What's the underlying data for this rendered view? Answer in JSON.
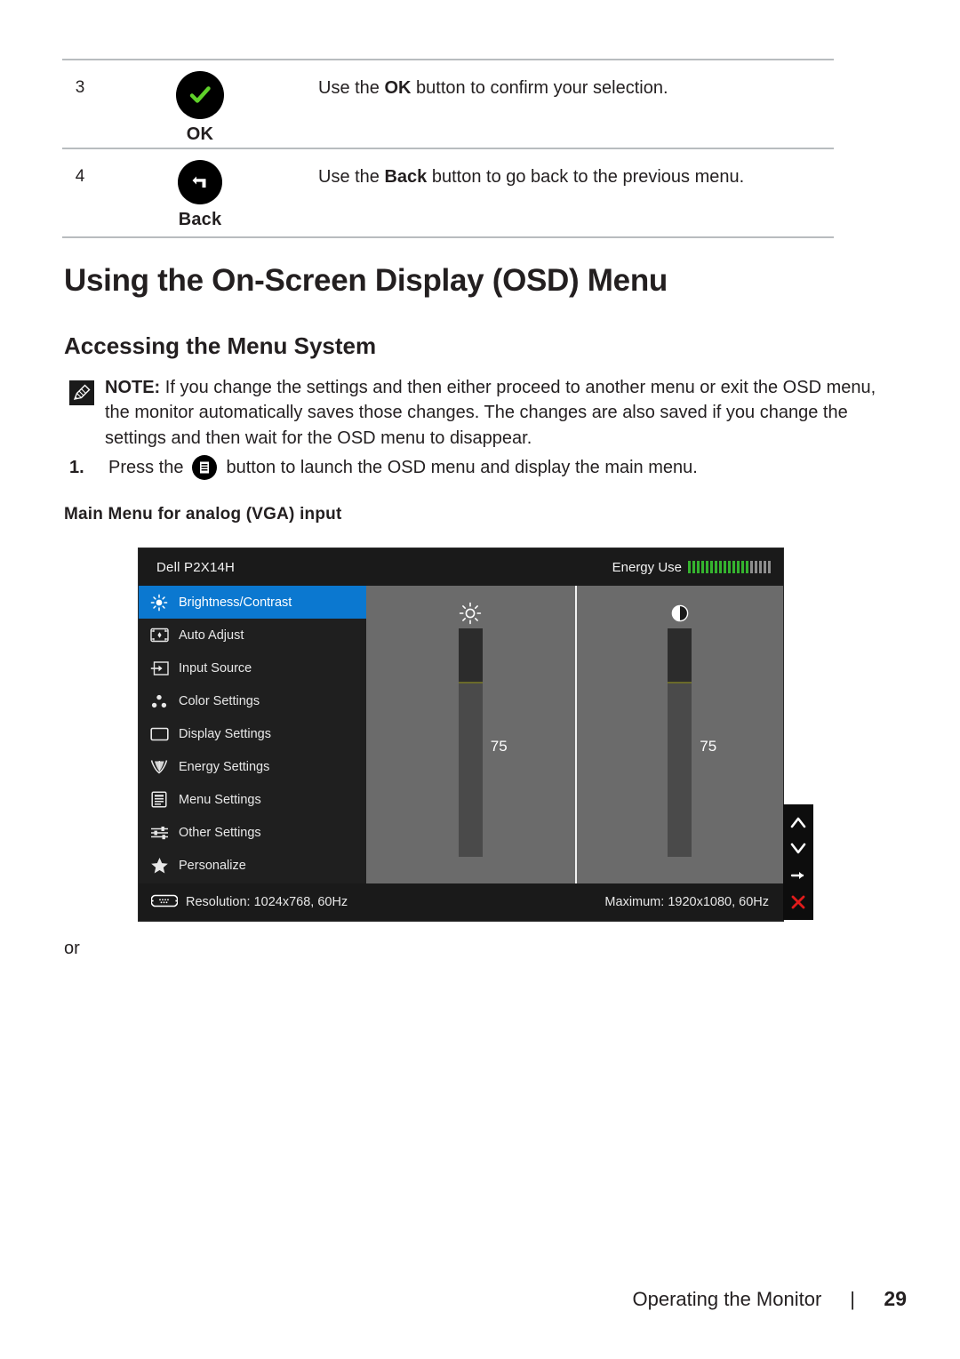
{
  "button_table": {
    "rows": [
      {
        "number": "3",
        "icon": "green-check-icon",
        "caption": "OK",
        "desc_before": "Use the ",
        "desc_bold": "OK",
        "desc_after": " button to confirm your selection."
      },
      {
        "number": "4",
        "icon": "back-arrow-icon",
        "caption": "Back",
        "desc_before": "Use the ",
        "desc_bold": "Back",
        "desc_after": " button to go back to the previous menu."
      }
    ]
  },
  "headings": {
    "h1": "Using the On-Screen Display (OSD) Menu",
    "h2": "Accessing the Menu System",
    "h3": "Main Menu for analog (VGA) input"
  },
  "note": {
    "label": "NOTE:",
    "text": " If you change the settings and then either proceed to another menu or exit the OSD menu, the monitor automatically saves those changes. The changes are also saved if you change the settings and then wait for the OSD menu to disappear."
  },
  "step1": {
    "number": "1.",
    "text_before": "Press the",
    "icon": "menu-button-icon",
    "text_after": "button to launch the OSD menu and display the main menu."
  },
  "osd": {
    "model": "Dell P2X14H",
    "energy_label": "Energy Use",
    "energy_bars_on": 14,
    "energy_bars_off": 5,
    "menu_items": [
      {
        "label": "Brightness/Contrast",
        "icon": "brightness-icon",
        "active": true
      },
      {
        "label": "Auto Adjust",
        "icon": "auto-adjust-icon",
        "active": false
      },
      {
        "label": "Input Source",
        "icon": "input-source-icon",
        "active": false
      },
      {
        "label": "Color Settings",
        "icon": "color-settings-icon",
        "active": false
      },
      {
        "label": "Display Settings",
        "icon": "display-settings-icon",
        "active": false
      },
      {
        "label": "Energy Settings",
        "icon": "energy-settings-icon",
        "active": false
      },
      {
        "label": "Menu Settings",
        "icon": "menu-settings-icon",
        "active": false
      },
      {
        "label": "Other Settings",
        "icon": "other-settings-icon",
        "active": false
      },
      {
        "label": "Personalize",
        "icon": "personalize-star-icon",
        "active": false
      }
    ],
    "sliders": [
      {
        "name": "brightness",
        "icon": "sun-icon",
        "value": "75"
      },
      {
        "name": "contrast",
        "icon": "contrast-icon",
        "value": "75"
      }
    ],
    "footer": {
      "resolution": "Resolution: 1024x768, 60Hz",
      "maximum": "Maximum: 1920x1080, 60Hz",
      "connector_icon": "vga-connector-icon"
    },
    "nav_buttons": [
      {
        "name": "up-arrow-icon",
        "glyph": "∧"
      },
      {
        "name": "down-arrow-icon",
        "glyph": "∨"
      },
      {
        "name": "right-arrow-icon",
        "glyph": "→"
      },
      {
        "name": "close-x-icon",
        "glyph": "✕"
      }
    ],
    "colors": {
      "highlight": "#0b78d0",
      "panel_bg": "#6b6b6b",
      "energy_on": "#35b32f",
      "close_red": "#e01b1b"
    }
  },
  "or_text": "or",
  "footer": {
    "section": "Operating the Monitor",
    "divider": "|",
    "page": "29"
  }
}
